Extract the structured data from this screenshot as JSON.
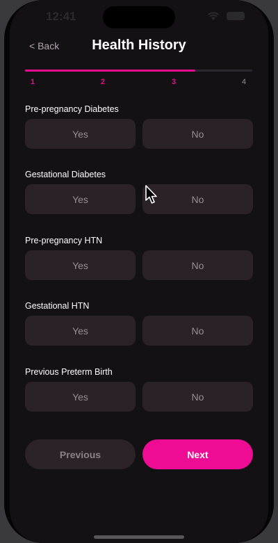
{
  "status_bar": {
    "time": "12:41"
  },
  "nav": {
    "back_label": "< Back",
    "title": "Health History"
  },
  "progress": {
    "current_step": 3,
    "total_steps": 4,
    "fraction": 0.75,
    "steps": [
      "1",
      "2",
      "3",
      "4"
    ]
  },
  "questions": [
    {
      "label": "Pre-pregnancy Diabetes",
      "yes": "Yes",
      "no": "No"
    },
    {
      "label": "Gestational Diabetes",
      "yes": "Yes",
      "no": "No"
    },
    {
      "label": "Pre-pregnancy HTN",
      "yes": "Yes",
      "no": "No"
    },
    {
      "label": "Gestational HTN",
      "yes": "Yes",
      "no": "No"
    },
    {
      "label": "Previous Preterm Birth",
      "yes": "Yes",
      "no": "No"
    }
  ],
  "footer": {
    "previous_label": "Previous",
    "next_label": "Next"
  },
  "colors": {
    "accent": "#ee0c94",
    "background": "#141114",
    "option_bg": "#2b2228"
  }
}
